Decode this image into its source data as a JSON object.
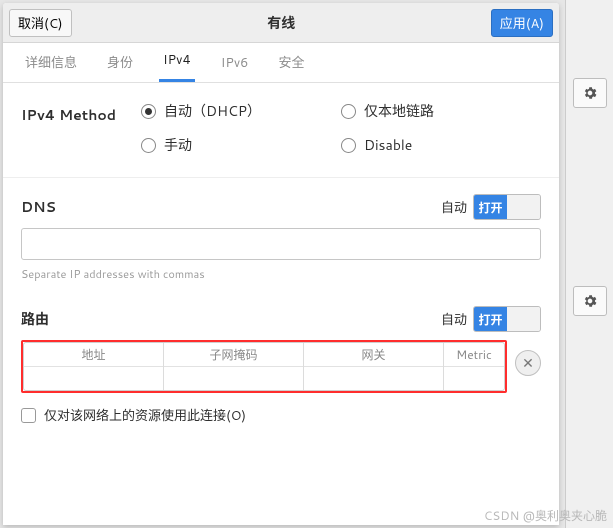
{
  "titlebar": {
    "cancel": "取消(C)",
    "title": "有线",
    "apply": "应用(A)"
  },
  "tabs": {
    "details": "详细信息",
    "identity": "身份",
    "ipv4": "IPv4",
    "ipv6": "IPv6",
    "security": "安全"
  },
  "method": {
    "label": "IPv4 Method",
    "auto": "自动（DHCP）",
    "linklocal": "仅本地链路",
    "manual": "手动",
    "disable": "Disable"
  },
  "dns": {
    "label": "DNS",
    "auto_label": "自动",
    "switch_on": "打开",
    "hint": "Separate IP addresses with commas"
  },
  "route": {
    "label": "路由",
    "auto_label": "自动",
    "switch_on": "打开",
    "col_addr": "地址",
    "col_mask": "子网掩码",
    "col_gw": "网关",
    "col_metric": "Metric"
  },
  "only_this": "仅对该网络上的资源使用此连接(O)",
  "watermark": "CSDN @奥利奥夹心脆"
}
